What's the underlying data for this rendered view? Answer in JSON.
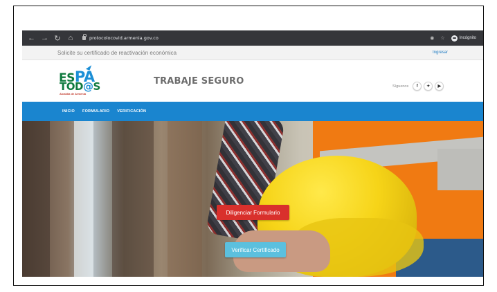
{
  "browser": {
    "url": "protocolocovid.armenia.gov.co",
    "incognito_label": "Incógnito",
    "nav_icons": [
      "back-icon",
      "forward-icon",
      "reload-icon",
      "home-icon"
    ]
  },
  "announcement": {
    "text": "Solicite su certificado de reactivación económica",
    "login_label": "Ingresar"
  },
  "header": {
    "logo": {
      "line1_prefix": "ES",
      "line1_accent": "PA",
      "line2_prefix": "TOD",
      "line2_accent": "@",
      "line2_suffix": "S",
      "tagline": "Alcaldía de Armenia"
    },
    "title": "TRABAJE SEGURO",
    "social_label": "Síguenos",
    "social": [
      {
        "icon": "facebook-icon",
        "glyph": "f"
      },
      {
        "icon": "twitter-icon",
        "glyph": "♥"
      },
      {
        "icon": "youtube-icon",
        "glyph": "▶"
      }
    ]
  },
  "nav": {
    "items": [
      "INICIO",
      "FORMULARIO",
      "VERIFICACIÓN"
    ]
  },
  "hero": {
    "primary_button": "Diligenciar Formulario",
    "secondary_button": "Verificar Certificado"
  },
  "colors": {
    "nav_blue": "#1a85cf",
    "primary_red": "#d9302c",
    "secondary_cyan": "#5bc0de"
  }
}
